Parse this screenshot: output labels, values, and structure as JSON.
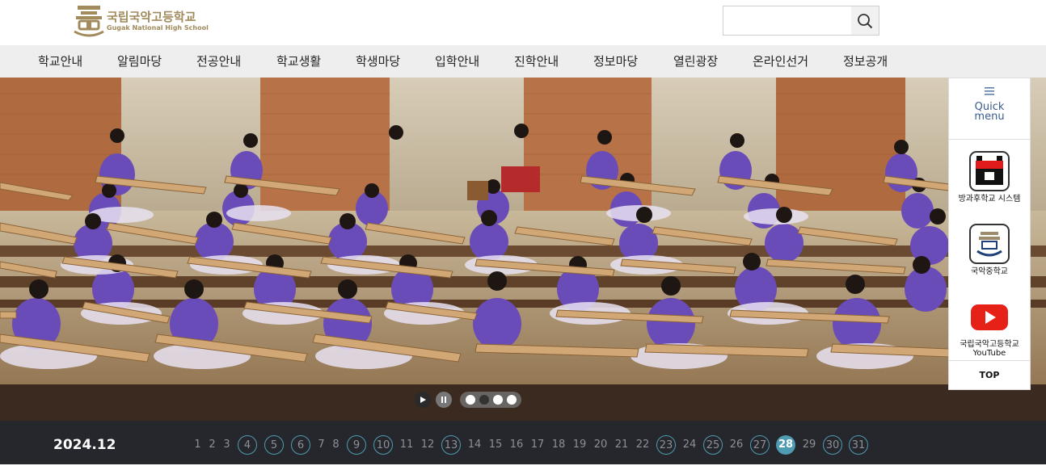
{
  "header": {
    "logo_ko": "국립국악고등학교",
    "logo_en": "Gugak National High School",
    "search_placeholder": "",
    "search_icon": "search-icon"
  },
  "nav": {
    "items": [
      "학교안내",
      "알림마당",
      "전공안내",
      "학교생활",
      "학생마당",
      "입학안내",
      "진학안내",
      "정보마당",
      "열린광장",
      "온라인선거",
      "정보공개"
    ]
  },
  "slider": {
    "play_icon": "play-icon",
    "pause_icon": "pause-icon",
    "slide_count": 4,
    "active_index": 1
  },
  "quick": {
    "title_line1": "Quick",
    "title_line2": "menu",
    "items": [
      {
        "label": "방과후학교 시스템",
        "icon": "afterschool-icon"
      },
      {
        "label": "국악중학교",
        "icon": "school-emblem-icon"
      },
      {
        "label": "국립국악고등학교 YouTube",
        "icon": "youtube-icon"
      }
    ],
    "top_label": "TOP"
  },
  "calendar": {
    "title": "2024.12",
    "days": [
      "1",
      "2",
      "3",
      "4",
      "5",
      "6",
      "7",
      "8",
      "9",
      "10",
      "11",
      "12",
      "13",
      "14",
      "15",
      "16",
      "17",
      "18",
      "19",
      "20",
      "21",
      "22",
      "23",
      "24",
      "25",
      "26",
      "27",
      "28",
      "29",
      "30",
      "31"
    ],
    "event_days": [
      "4",
      "5",
      "6",
      "9",
      "10",
      "13",
      "23",
      "25",
      "27",
      "30",
      "31"
    ],
    "today": "28"
  },
  "colors": {
    "accent": "#4f9bb1",
    "logo_gold": "#a18b5c",
    "calendar_bg": "#25272d",
    "nav_bg": "#eeeeee"
  }
}
